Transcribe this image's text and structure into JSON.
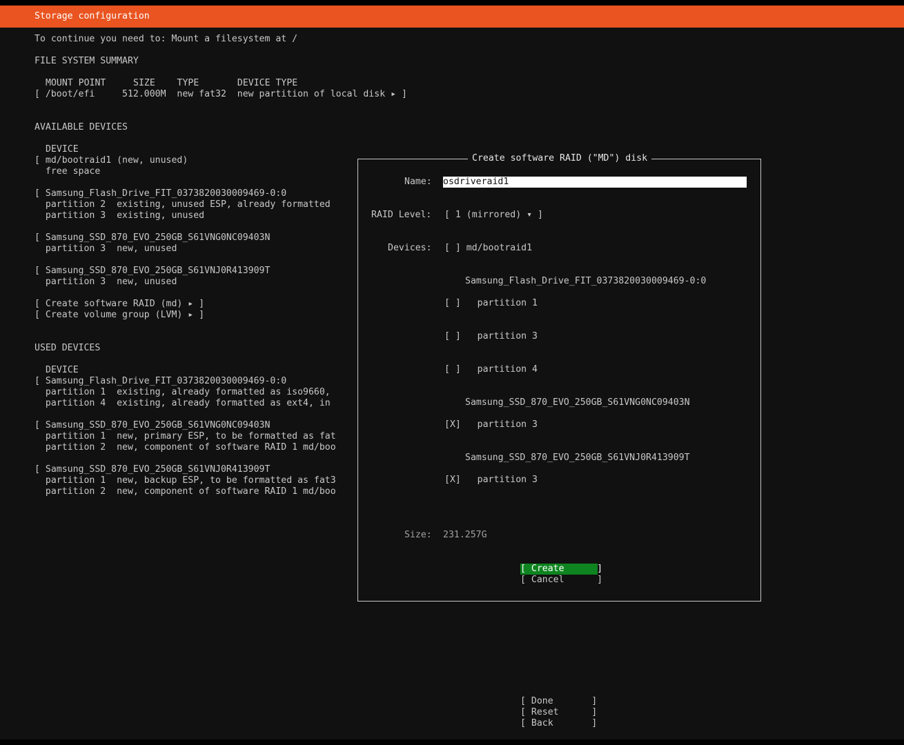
{
  "header": {
    "title": "Storage configuration"
  },
  "notice": "To continue you need to: Mount a filesystem at /",
  "fs_summary": {
    "heading": "FILE SYSTEM SUMMARY",
    "columns": "MOUNT POINT     SIZE    TYPE       DEVICE TYPE",
    "row": "[ /boot/efi     512.000M  new fat32  new partition of local disk ▸ ]"
  },
  "available": {
    "heading": "AVAILABLE DEVICES",
    "col": "DEVICE",
    "lines": [
      "[ md/bootraid1 (new, unused)",
      "  free space",
      "[ Samsung_Flash_Drive_FIT_0373820030009469-0:0",
      "  partition 2  existing, unused ESP, already formatted",
      "  partition 3  existing, unused",
      "[ Samsung_SSD_870_EVO_250GB_S61VNG0NC09403N",
      "  partition 3  new, unused",
      "[ Samsung_SSD_870_EVO_250GB_S61VNJ0R413909T",
      "  partition 3  new, unused",
      "[ Create software RAID (md) ▸ ]",
      "[ Create volume group (LVM) ▸ ]"
    ]
  },
  "used": {
    "heading": "USED DEVICES",
    "col": "DEVICE",
    "lines": [
      "[ Samsung_Flash_Drive_FIT_0373820030009469-0:0",
      "  partition 1  existing, already formatted as iso9660,",
      "  partition 4  existing, already formatted as ext4, in",
      "[ Samsung_SSD_870_EVO_250GB_S61VNG0NC09403N",
      "  partition 1  new, primary ESP, to be formatted as fat",
      "  partition 2  new, component of software RAID 1 md/boo",
      "[ Samsung_SSD_870_EVO_250GB_S61VNJ0R413909T",
      "  partition 1  new, backup ESP, to be formatted as fat3",
      "  partition 2  new, component of software RAID 1 md/boo"
    ]
  },
  "dialog": {
    "title": "Create software RAID (\"MD\") disk",
    "name_label": "Name:",
    "name_value": "osdriveraid1",
    "raid_label": "RAID Level:",
    "raid_value": "[ 1 (mirrored) ▾ ]",
    "devices_label": "Devices:",
    "dev1": "[ ] md/bootraid1",
    "disk1": "Samsung_Flash_Drive_FIT_0373820030009469-0:0",
    "d1p1": "[ ]   partition 1",
    "d1p3": "[ ]   partition 3",
    "d1p4": "[ ]   partition 4",
    "disk2": "Samsung_SSD_870_EVO_250GB_S61VNG0NC09403N",
    "d2p3": "[X]   partition 3",
    "disk3": "Samsung_SSD_870_EVO_250GB_S61VNJ0R413909T",
    "d3p3": "[X]   partition 3",
    "size_label": "Size:",
    "size_value": "231.257G",
    "create_label": "[ Create      ]",
    "cancel_label": "[ Cancel      ]"
  },
  "footer": {
    "done": "[ Done       ]",
    "reset": "[ Reset      ]",
    "back": "[ Back       ]"
  }
}
